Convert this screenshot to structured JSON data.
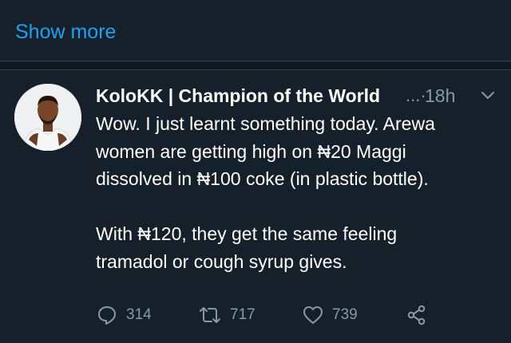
{
  "show_more": {
    "label": "Show more"
  },
  "tweet": {
    "display_name": "KoloKK | Champion of the World",
    "ellipsis": "...·",
    "time": "18h",
    "text_line1": "Wow. I just learnt something today. Arewa",
    "text_line2": "women are getting high on ₦20 Maggi",
    "text_line3": "dissolved in ₦100 coke (in plastic bottle).",
    "text_line4": "With ₦120, they get the same feeling",
    "text_line5": "tramadol or cough syrup gives.",
    "actions": {
      "replies": "314",
      "retweets": "717",
      "likes": "739"
    },
    "icons": [
      "reply-icon",
      "retweet-icon",
      "like-icon",
      "share-icon",
      "chevron-down-icon"
    ]
  },
  "colors": {
    "background": "#15202b",
    "accent": "#1da1f2",
    "muted": "#8899a6",
    "divider": "#38444d"
  }
}
